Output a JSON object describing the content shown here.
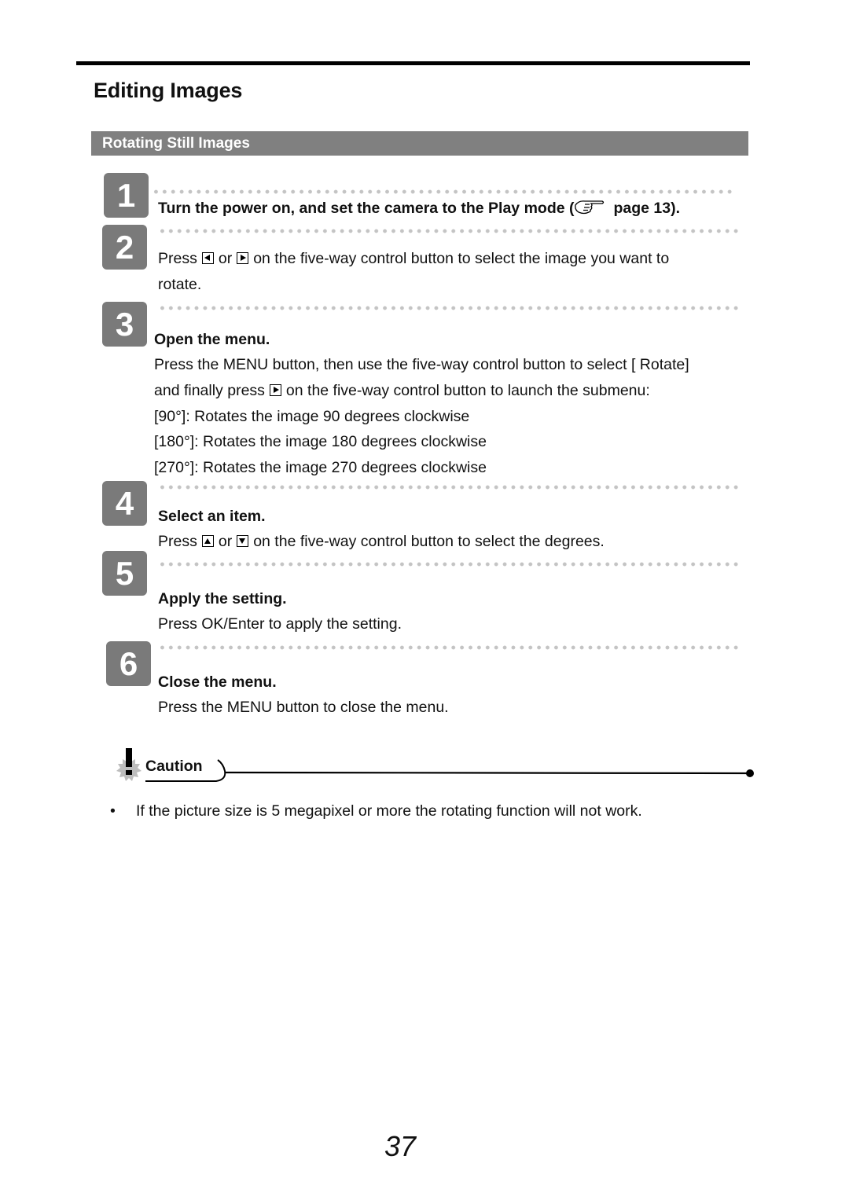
{
  "page": {
    "title": "Editing Images",
    "section_title": "Rotating Still Images",
    "page_number": "37"
  },
  "steps": [
    {
      "number": "1",
      "heading_before": "Turn the power on, and set the camera to the Play mode (",
      "heading_icon": "pointing-hand-icon",
      "heading_after": "page 13)."
    },
    {
      "number": "2",
      "body_press": "Press",
      "body_or": "or",
      "body_rest": "on the five-way control button to select the image you want to",
      "body_line2": "rotate.",
      "icons": [
        "left-arrow-button-icon",
        "right-arrow-button-icon"
      ]
    },
    {
      "number": "3",
      "heading": "Open the menu.",
      "line1": "Press the MENU button, then use the five-way control button to select [ Rotate]",
      "line2_before": "and finally press",
      "line2_after": "on the five-way control button to launch the submenu:",
      "icons": [
        "right-arrow-button-icon"
      ],
      "options": [
        "[90°]: Rotates the image 90 degrees clockwise",
        "[180°]: Rotates the image 180 degrees clockwise",
        "[270°]: Rotates the image 270 degrees clockwise"
      ]
    },
    {
      "number": "4",
      "heading": "Select an item.",
      "body_press": "Press",
      "body_or": "or",
      "body_rest": "on the five-way control button to select the degrees.",
      "icons": [
        "up-arrow-button-icon",
        "down-arrow-button-icon"
      ]
    },
    {
      "number": "5",
      "heading": "Apply the setting.",
      "body": "Press OK/Enter to apply the setting."
    },
    {
      "number": "6",
      "heading": "Close the menu.",
      "body": "Press the MENU button to close the menu."
    }
  ],
  "caution": {
    "label": "Caution",
    "icon": "caution-burst-icon",
    "items": [
      "If the picture size is 5 megapixel or more the rotating function will not work."
    ]
  }
}
